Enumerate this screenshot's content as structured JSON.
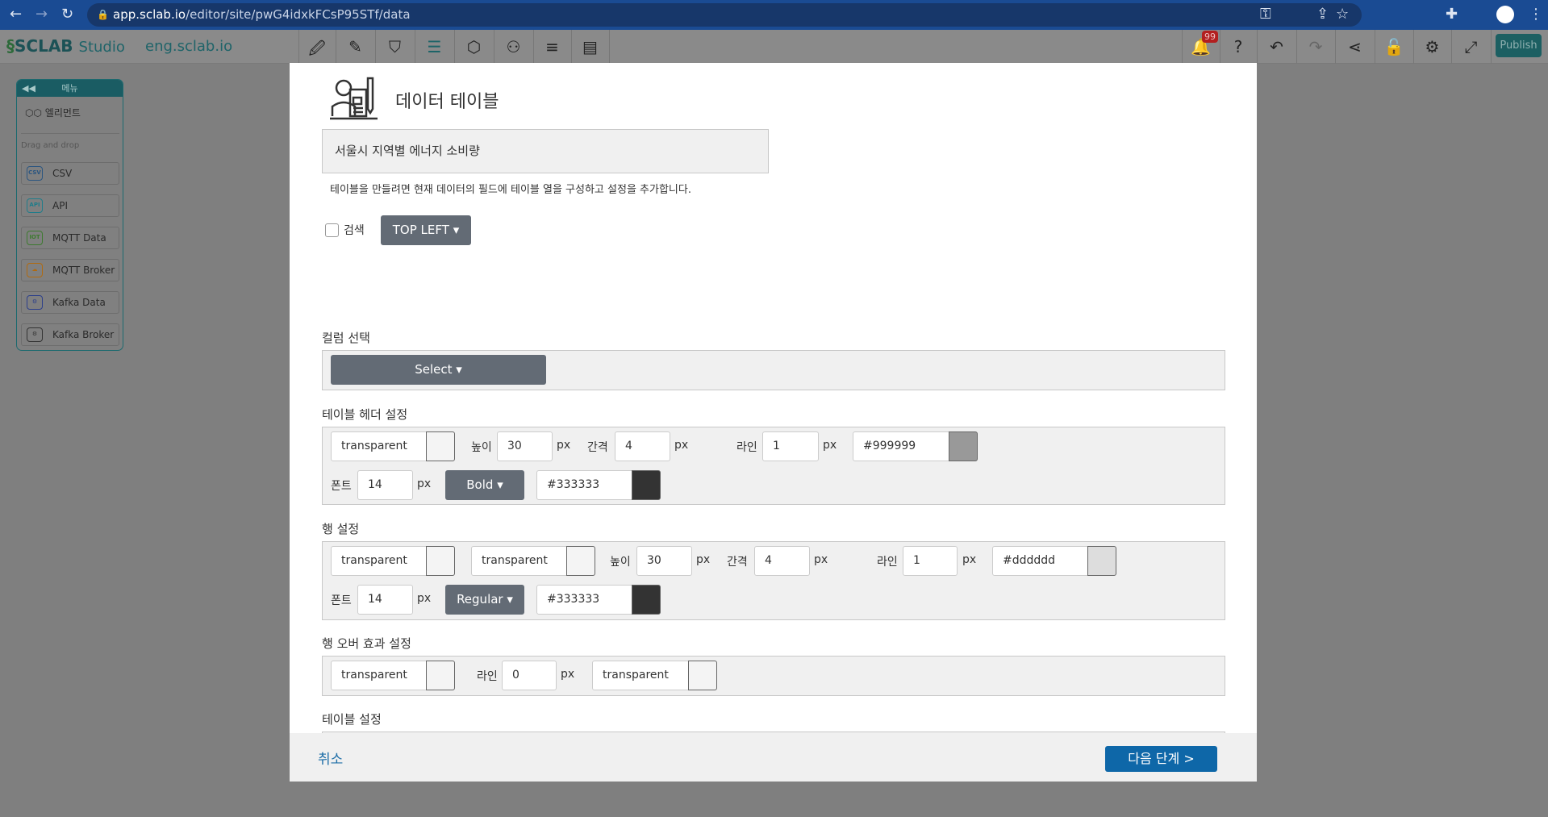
{
  "browser": {
    "url_host": "app.sclab.io",
    "url_path": "/editor/site/pwG4idxkFCsP95STf/data"
  },
  "app": {
    "logo_main": "SCLAB",
    "logo_sub": "Studio",
    "site": "eng.sclab.io",
    "notification_count": "99",
    "publish": "Publish",
    "toolbar_icons": [
      "desktop-edit-icon",
      "mobile-edit-icon",
      "map-icon",
      "database-icon",
      "code-icon",
      "users-icon",
      "list-icon",
      "card-icon"
    ],
    "right_icons": [
      "bell-icon",
      "help-icon",
      "undo-icon",
      "redo-icon",
      "share-icon",
      "unlock-icon",
      "gear-icon",
      "fullscreen-icon"
    ]
  },
  "sidebar": {
    "title": "메뉴",
    "element": "엘리먼트",
    "section": "Drag and drop",
    "items": [
      {
        "label": "CSV",
        "icon": "CSV",
        "color": "#2a5580"
      },
      {
        "label": "API",
        "icon": "API",
        "color": "#1f7c8a"
      },
      {
        "label": "MQTT Data",
        "icon": "IOT",
        "color": "#3d7a2f"
      },
      {
        "label": "MQTT Broker",
        "icon": "☁",
        "color": "#b06a10"
      },
      {
        "label": "Kafka Data",
        "icon": "⚙",
        "color": "#2c3f8a"
      },
      {
        "label": "Kafka Broker",
        "icon": "⚙",
        "color": "#333333"
      }
    ]
  },
  "modal": {
    "title": "데이터 테이블",
    "name": "서울시 지역별 에너지 소비량",
    "description": "테이블을 만들려면 현재 데이터의 필드에 테이블 열을 구성하고 설정을 추가합니다.",
    "search_label": "검색",
    "search_checked": false,
    "position": "TOP LEFT",
    "column": {
      "label": "컬럼 선택",
      "select": "Select"
    },
    "header": {
      "label": "테이블 헤더 설정",
      "bg": "transparent",
      "height_label": "높이",
      "height": "30",
      "gap_label": "간격",
      "gap": "4",
      "line_label": "라인",
      "line": "1",
      "line_color": "#999999",
      "font_label": "폰트",
      "font": "14",
      "weight": "Bold",
      "font_color": "#333333",
      "unit": "px"
    },
    "row": {
      "label": "행 설정",
      "bg1": "transparent",
      "bg2": "transparent",
      "height_label": "높이",
      "height": "30",
      "gap_label": "간격",
      "gap": "4",
      "line_label": "라인",
      "line": "1",
      "line_color": "#dddddd",
      "font_label": "폰트",
      "font": "14",
      "weight": "Regular",
      "font_color": "#333333",
      "unit": "px"
    },
    "hover": {
      "label": "행 오버 효과 설정",
      "bg": "transparent",
      "line_label": "라인",
      "line": "0",
      "unit": "px",
      "color2": "transparent"
    },
    "table": {
      "label": "테이블 설정"
    },
    "cancel": "취소",
    "next": "다음 단계 >"
  }
}
